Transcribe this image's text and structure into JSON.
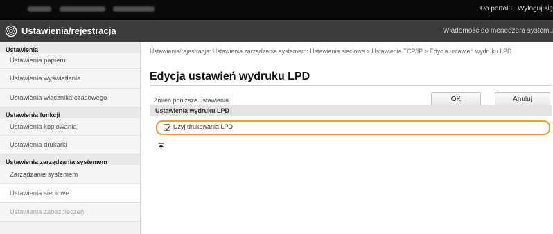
{
  "topbar": {
    "portal_link": "Do portalu",
    "logout_link": "Wyloguj się"
  },
  "header": {
    "title": "Ustawienia/rejestracja",
    "message_link": "Wiadomość do menedżera systemu"
  },
  "sidebar": {
    "groups": [
      {
        "heading": "Ustawienia",
        "items": [
          {
            "label": "Ustawienia papieru"
          },
          {
            "label": "Ustawienia wyświetlania"
          },
          {
            "label": "Ustawienia włącznika czasowego"
          }
        ]
      },
      {
        "heading": "Ustawienia funkcji",
        "items": [
          {
            "label": "Ustawienia kopiowania"
          },
          {
            "label": "Ustawienia drukarki"
          }
        ]
      },
      {
        "heading": "Ustawienia zarządzania systemem",
        "items": [
          {
            "label": "Zarządzanie systemem"
          },
          {
            "label": "Ustawienia sieciowe"
          },
          {
            "label": "Ustawienia zabezpieczeń"
          }
        ]
      }
    ]
  },
  "main": {
    "breadcrumb": "Ustawienia/rejestracja: Ustawienia zarządzania systemem: Ustawienia sieciowe > Ustawienia TCP/IP > Edycja ustawień wydruku LPD",
    "title": "Edycja ustawień wydruku LPD",
    "instruction": "Zmień poniższe ustawienia.",
    "ok_label": "OK",
    "cancel_label": "Anuluj",
    "section_title": "Ustawienia wydruku LPD",
    "option_label": "Użyj drukowania LPD",
    "option_checked": true
  },
  "colors": {
    "highlight": "#f0a02a",
    "title_bar": "#3b3b3b",
    "top_bar": "#0a0a0a"
  }
}
